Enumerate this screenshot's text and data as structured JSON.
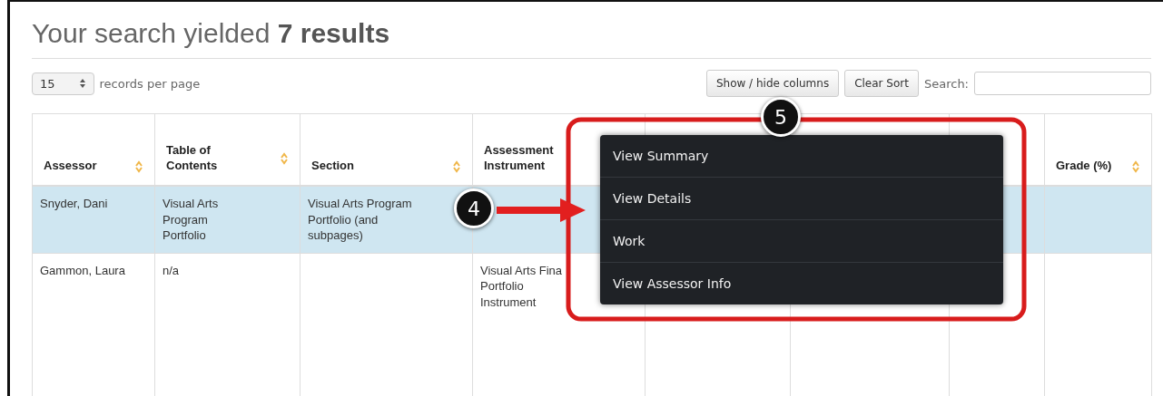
{
  "heading": "Your search yielded **7 results**",
  "page_size": {
    "value": "15",
    "label": "records per page"
  },
  "buttons": [
    "Show / hide columns",
    "Clear Sort"
  ],
  "search": {
    "label": "Search:"
  },
  "table": {
    "columns": [
      {
        "label": "Assessor",
        "sortable": true
      },
      {
        "label": "Table of Contents",
        "sortable": true
      },
      {
        "label": "Section",
        "sortable": true
      },
      {
        "label": "Assessment Instrument"
      },
      {},
      {},
      {},
      {
        "label": "Grade (%)",
        "sortable": true
      }
    ],
    "rows": [
      {
        "selected": true,
        "cells": [
          "Snyder, Dani",
          "Visual Arts Program Portfolio",
          "Visual Arts Program Portfolio (and subpages)",
          "",
          "",
          "",
          "",
          ""
        ]
      },
      {
        "selected": false,
        "cells": [
          "Gammon, Laura",
          "n/a",
          "",
          "Visual Arts Fina Portfolio Instrument",
          "",
          "",
          "",
          ""
        ]
      }
    ]
  },
  "context_menu": {
    "items": [
      "View Summary",
      "View Details",
      "Work",
      "View Assessor Info"
    ]
  },
  "callouts": [
    {
      "label": "4"
    },
    {
      "label": "5"
    }
  ]
}
